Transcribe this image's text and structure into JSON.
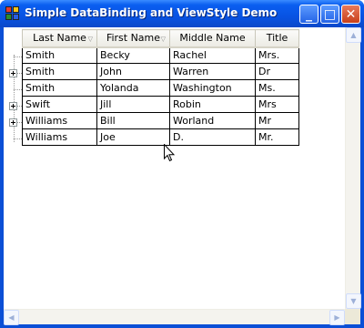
{
  "window": {
    "title": "Simple DataBinding and ViewStyle Demo",
    "minimize_glyph": "_",
    "maximize_glyph": "□",
    "close_glyph": "✕"
  },
  "grid": {
    "columns": [
      "Last Name",
      "First Name",
      "Middle Name",
      "Title"
    ],
    "rows": [
      {
        "last": "Smith",
        "first": "Becky",
        "middle": "Rachel",
        "title": "Mrs.",
        "expandable": false
      },
      {
        "last": "Smith",
        "first": "John",
        "middle": "Warren",
        "title": "Dr",
        "expandable": true
      },
      {
        "last": "Smith",
        "first": "Yolanda",
        "middle": "Washington",
        "title": "Ms.",
        "expandable": false
      },
      {
        "last": "Swift",
        "first": "Jill",
        "middle": "Robin",
        "title": "Mrs",
        "expandable": true
      },
      {
        "last": "Williams",
        "first": "Bill",
        "middle": "Worland",
        "title": "Mr",
        "expandable": true
      },
      {
        "last": "Williams",
        "first": "Joe",
        "middle": "D.",
        "title": "Mr.",
        "expandable": false
      }
    ]
  },
  "scroll": {
    "up": "▲",
    "down": "▼",
    "left": "◀",
    "right": "▶"
  },
  "icons": {
    "app": "app-icon",
    "expand": "plus-expander-icon",
    "cursor": "mouse-pointer-icon"
  }
}
